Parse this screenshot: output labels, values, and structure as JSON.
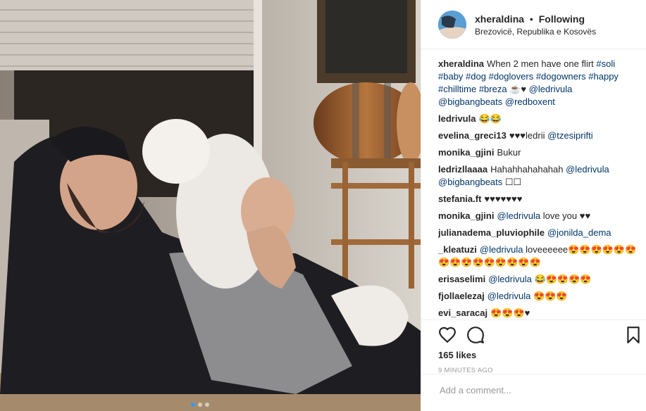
{
  "post": {
    "username": "xheraldina",
    "separator": "•",
    "follow_status": "Following",
    "location": "Brezovicë, Republika e Kosovës"
  },
  "comments": [
    {
      "user": "xheraldina",
      "parts": [
        {
          "t": "When 2 men have one flirt "
        },
        {
          "t": "#soli",
          "tag": true
        },
        {
          "t": " "
        },
        {
          "t": "#baby",
          "tag": true
        },
        {
          "t": " "
        },
        {
          "t": "#dog",
          "tag": true
        },
        {
          "t": " "
        },
        {
          "t": "#doglovers",
          "tag": true
        },
        {
          "t": " "
        },
        {
          "t": "#dogowners",
          "tag": true
        },
        {
          "t": " "
        },
        {
          "t": "#happy",
          "tag": true
        },
        {
          "t": " "
        },
        {
          "t": "#chilltime",
          "tag": true
        },
        {
          "t": " "
        },
        {
          "t": "#breza",
          "tag": true
        },
        {
          "t": " ☕♥ "
        },
        {
          "t": "@ledrivula",
          "tag": true
        },
        {
          "t": " "
        },
        {
          "t": "@bigbangbeats",
          "tag": true
        },
        {
          "t": " "
        },
        {
          "t": "@redboxent",
          "tag": true
        }
      ]
    },
    {
      "user": "ledrivula",
      "parts": [
        {
          "t": "😂😂"
        }
      ]
    },
    {
      "user": "evelina_greci13",
      "parts": [
        {
          "t": "♥♥♥ledrii "
        },
        {
          "t": "@tzesiprifti",
          "tag": true
        }
      ]
    },
    {
      "user": "monika_gjini",
      "parts": [
        {
          "t": "Bukur"
        }
      ]
    },
    {
      "user": "ledrizllaaaa",
      "parts": [
        {
          "t": "Hahahhahahahah "
        },
        {
          "t": "@ledrivula",
          "tag": true
        },
        {
          "t": " "
        },
        {
          "t": "@bigbangbeats",
          "tag": true
        },
        {
          "t": " ☐☐"
        }
      ]
    },
    {
      "user": "stefania.ft",
      "parts": [
        {
          "t": "♥♥♥♥♥♥♥"
        }
      ]
    },
    {
      "user": "monika_gjini",
      "parts": [
        {
          "t": "@ledrivula",
          "tag": true
        },
        {
          "t": " love you ♥♥"
        }
      ]
    },
    {
      "user": "julianadema_pluviophile",
      "parts": [
        {
          "t": "@jonilda_dema",
          "tag": true
        }
      ]
    },
    {
      "user": "_kleatuzi",
      "parts": [
        {
          "t": "@ledrivula",
          "tag": true
        },
        {
          "t": " loveeeeee😍😍😍😍😍😍😍😍😍😍😍😍😍😍😍"
        }
      ]
    },
    {
      "user": "erisaselimi",
      "parts": [
        {
          "t": "@ledrivula",
          "tag": true
        },
        {
          "t": " 😂😍😍😍😍"
        }
      ]
    },
    {
      "user": "fjollaelezaj",
      "parts": [
        {
          "t": "@ledrivula",
          "tag": true
        },
        {
          "t": " 😍😍😍"
        }
      ]
    },
    {
      "user": "evi_saracaj",
      "parts": [
        {
          "t": "😍😍😍♥"
        }
      ]
    }
  ],
  "likes": "165 likes",
  "timestamp": "9 MINUTES AGO",
  "add_comment": {
    "placeholder": "Add a comment..."
  },
  "icons": {
    "like": "heart-icon",
    "comment": "comment-icon",
    "save": "bookmark-icon"
  },
  "colors": {
    "link": "#003569",
    "border": "#efefef",
    "muted": "#999999",
    "active_dot": "#3897f0"
  }
}
